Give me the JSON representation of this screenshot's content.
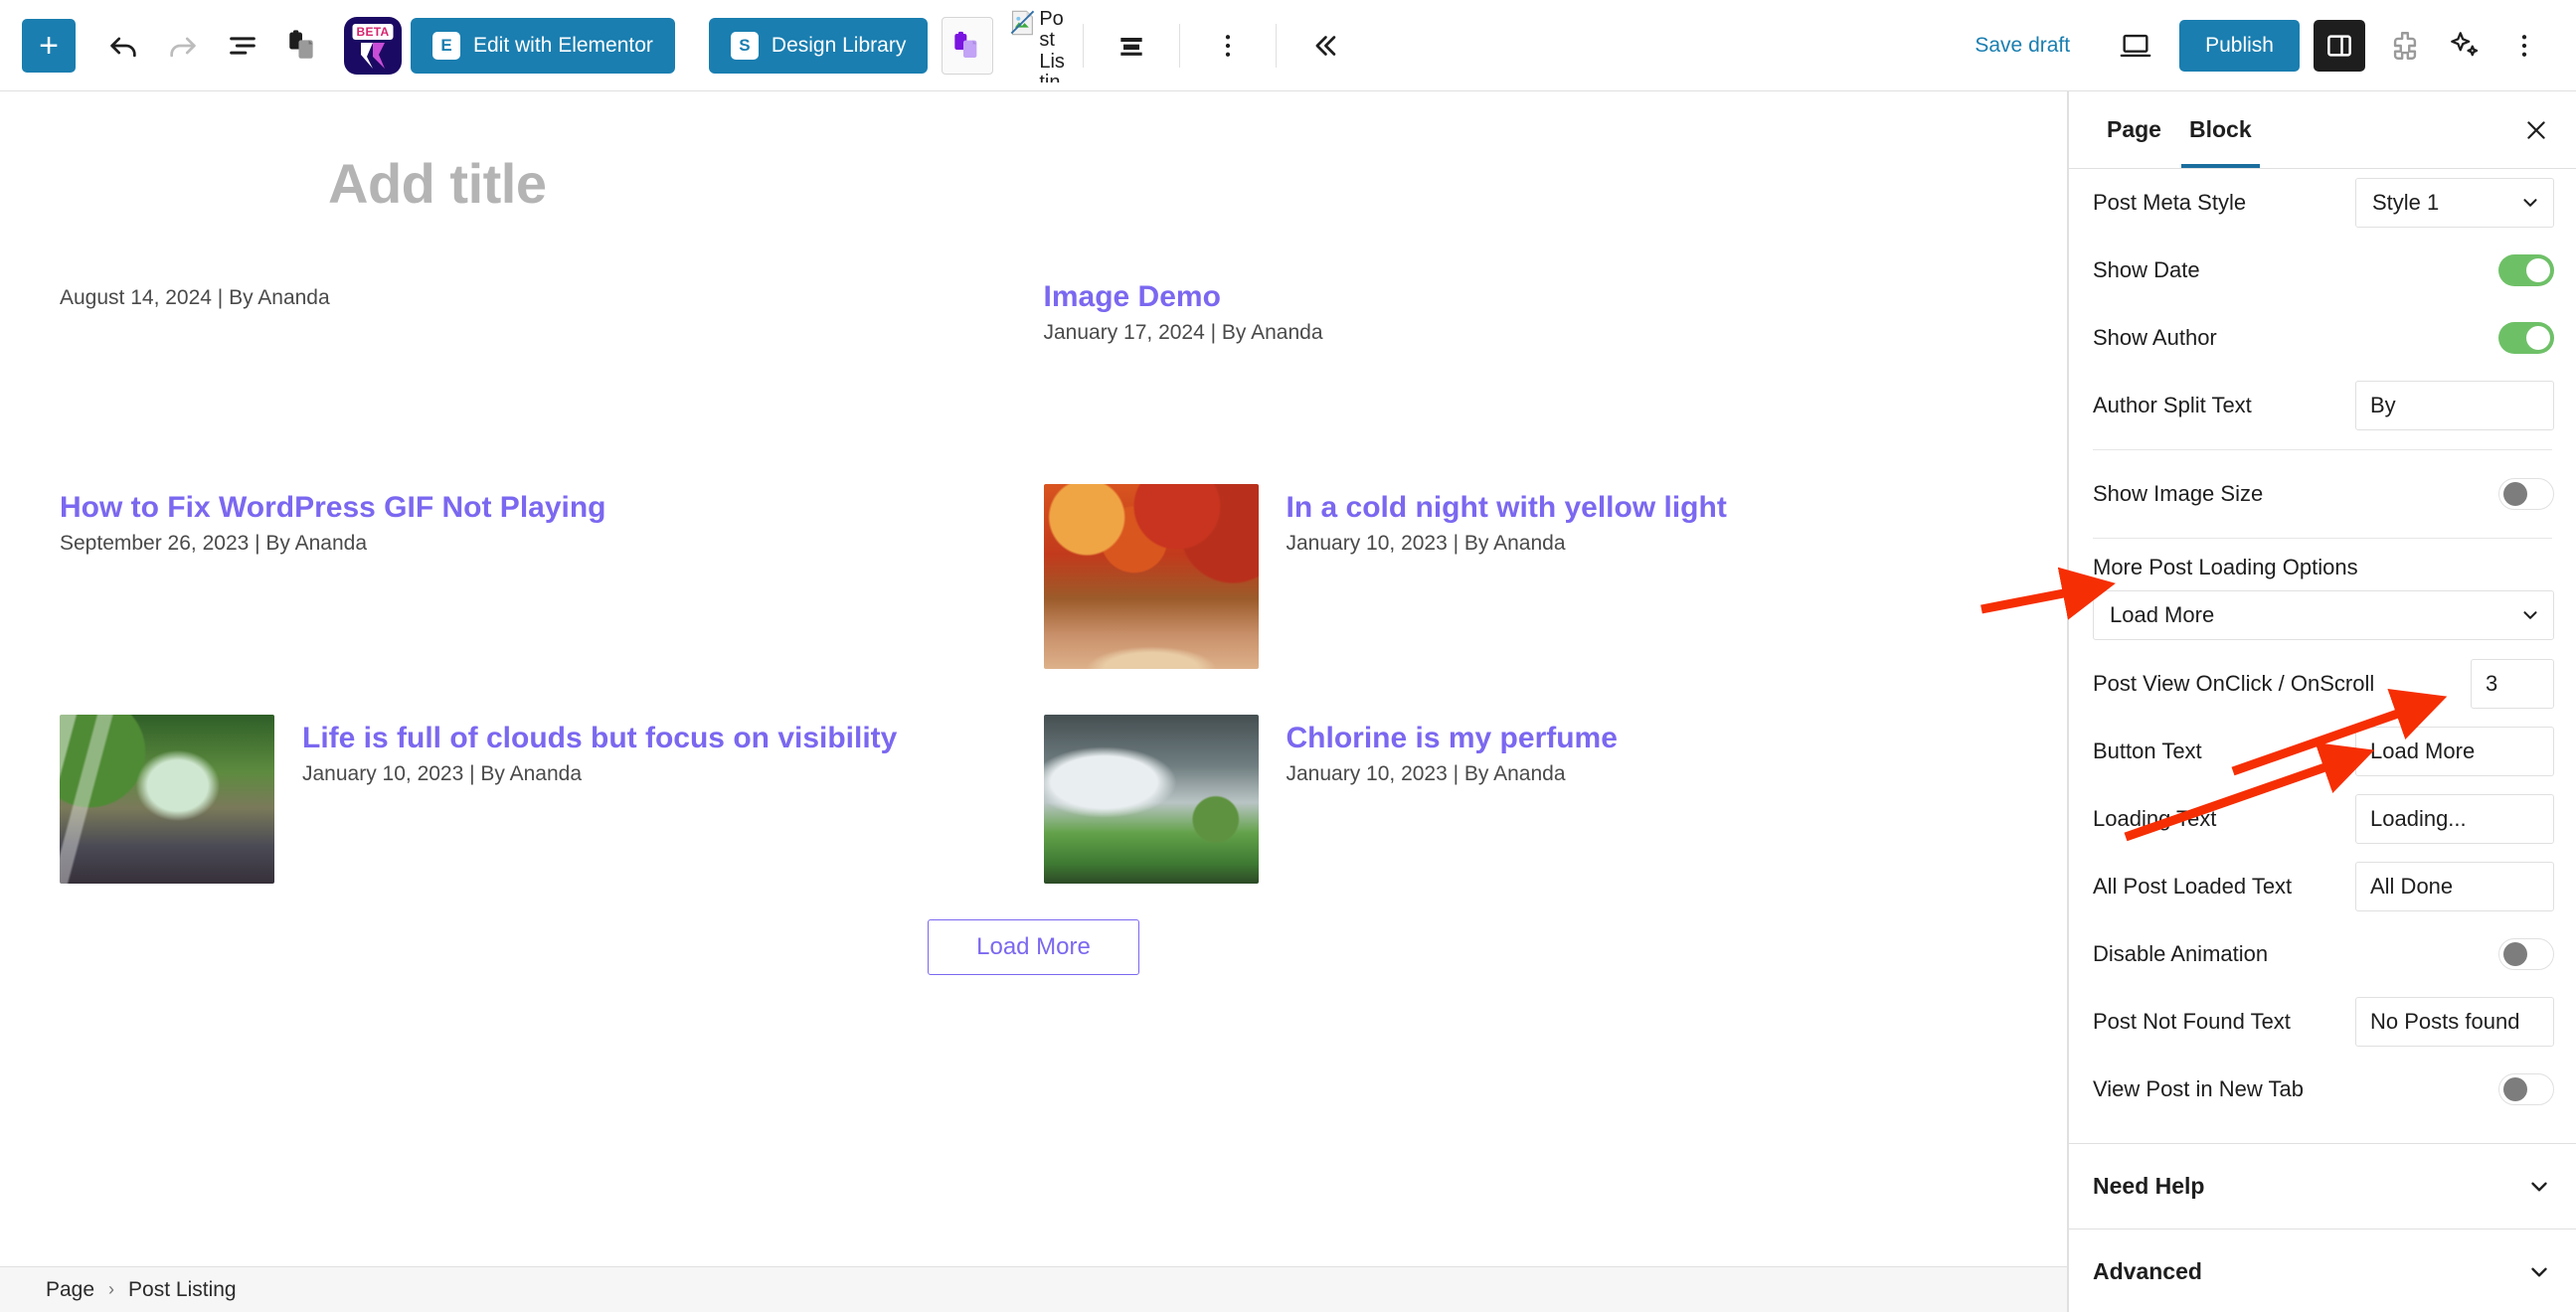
{
  "toolbar": {
    "inserter_label": "+",
    "undo_icon": "undo-icon",
    "redo_icon": "redo-icon",
    "list_view_icon": "list-view-icon",
    "copy_icon": "copy-icon",
    "beta_badge": "BETA",
    "elementor_button": "Edit with Elementor",
    "elementor_glyph": "E",
    "design_library_button": "Design Library",
    "design_library_glyph": "S",
    "broken_image_alt": "Post Listing",
    "save_draft": "Save draft",
    "publish": "Publish",
    "view_icon": "desktop-preview-icon",
    "settings_icon": "settings-sidebar-icon",
    "plugin_icon": "plugin-icon",
    "ai_icon": "sparkle-ai-icon",
    "options_icon": "more-options-icon",
    "collapse_icon": "collapse-chevrons-icon"
  },
  "editor": {
    "title_placeholder": "Add title",
    "load_more_button": "Load More",
    "breadcrumb": {
      "root": "Page",
      "separator": "›",
      "current": "Post Listing"
    },
    "posts": [
      {
        "title": "",
        "meta": "August 14, 2024 | By Ananda",
        "thumb": "none"
      },
      {
        "title": "Image Demo",
        "meta": "January 17, 2024 | By Ananda",
        "thumb": "none"
      },
      {
        "title": "How to Fix WordPress GIF Not Playing",
        "meta": "September 26, 2023 | By Ananda",
        "thumb": "none"
      },
      {
        "title": "In a cold night with yellow light",
        "meta": "January 10, 2023 | By Ananda",
        "thumb": "autumn-forest-path"
      },
      {
        "title": "Life is full of clouds but focus on visibility",
        "meta": "January 10, 2023 | By Ananda",
        "thumb": "sunbeam-forest-road"
      },
      {
        "title": "Chlorine is my perfume",
        "meta": "January 10, 2023 | By Ananda",
        "thumb": "lone-tree-stormy-sky"
      }
    ]
  },
  "sidebar": {
    "tabs": [
      {
        "label": "Page",
        "active": false
      },
      {
        "label": "Block",
        "active": true
      }
    ],
    "close_icon": "close-icon",
    "settings": [
      {
        "name": "post-meta-style",
        "label": "Post Meta Style",
        "type": "select",
        "value": "Style 1"
      },
      {
        "name": "show-date",
        "label": "Show Date",
        "type": "toggle",
        "value": "on"
      },
      {
        "name": "show-author",
        "label": "Show Author",
        "type": "toggle",
        "value": "on"
      },
      {
        "name": "author-split-text",
        "label": "Author Split Text",
        "type": "text",
        "value": "By"
      },
      {
        "name": "show-image-size",
        "label": "Show Image Size",
        "type": "toggle",
        "value": "off"
      },
      {
        "name": "more-post-loading",
        "label": "More Post Loading Options",
        "type": "select-stacked",
        "value": "Load More"
      },
      {
        "name": "post-view-onclick",
        "label": "Post View OnClick / OnScroll",
        "type": "number",
        "value": "3"
      },
      {
        "name": "button-text",
        "label": "Button Text",
        "type": "text",
        "value": "Load More"
      },
      {
        "name": "loading-text",
        "label": "Loading Text",
        "type": "text",
        "value": "Loading..."
      },
      {
        "name": "all-post-loaded-text",
        "label": "All Post Loaded Text",
        "type": "text",
        "value": "All Done"
      },
      {
        "name": "disable-animation",
        "label": "Disable Animation",
        "type": "toggle",
        "value": "off"
      },
      {
        "name": "post-not-found-text",
        "label": "Post Not Found Text",
        "type": "text",
        "value": "No Posts found"
      },
      {
        "name": "view-post-new-tab",
        "label": "View Post in New Tab",
        "type": "toggle",
        "value": "off"
      }
    ],
    "panels": [
      {
        "name": "need-help",
        "label": "Need Help"
      },
      {
        "name": "advanced",
        "label": "Advanced"
      }
    ]
  },
  "colors": {
    "accent_blue": "#1a7eb0",
    "link_purple": "#7b68f0",
    "toggle_green": "#6ec067",
    "annotation_red": "#f62e03"
  }
}
